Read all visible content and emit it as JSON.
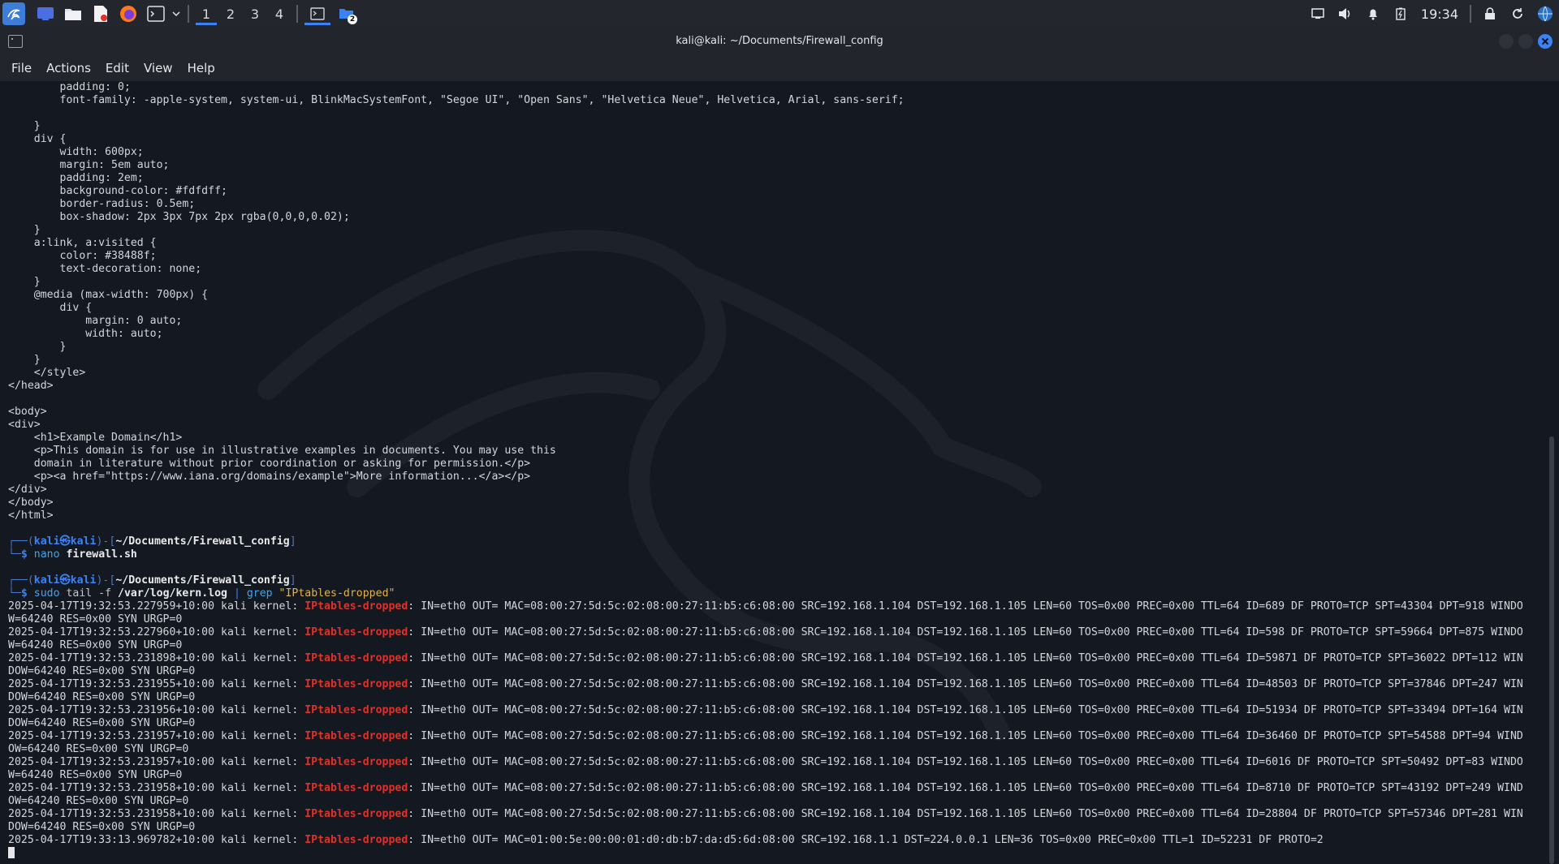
{
  "taskbar": {
    "workspaces": [
      "1",
      "2",
      "3",
      "4"
    ],
    "active_workspace": 0,
    "clock": "19:34",
    "badge": "2",
    "icons": [
      "kali-menu-icon",
      "desktop-icon",
      "file-manager-icon",
      "text-editor-icon",
      "firefox-icon",
      "terminal-icon",
      "dropdown-icon"
    ],
    "tray_icons": [
      "display-icon",
      "volume-icon",
      "bell-icon",
      "battery-icon",
      "lock-icon",
      "refresh-icon",
      "network-icon"
    ]
  },
  "window": {
    "title": "kali@kali: ~/Documents/Firewall_config"
  },
  "menu": [
    "File",
    "Actions",
    "Edit",
    "View",
    "Help"
  ],
  "terminal": {
    "html_lines": [
      "        padding: 0;",
      "        font-family: -apple-system, system-ui, BlinkMacSystemFont, \"Segoe UI\", \"Open Sans\", \"Helvetica Neue\", Helvetica, Arial, sans-serif;",
      "",
      "    }",
      "    div {",
      "        width: 600px;",
      "        margin: 5em auto;",
      "        padding: 2em;",
      "        background-color: #fdfdff;",
      "        border-radius: 0.5em;",
      "        box-shadow: 2px 3px 7px 2px rgba(0,0,0,0.02);",
      "    }",
      "    a:link, a:visited {",
      "        color: #38488f;",
      "        text-decoration: none;",
      "    }",
      "    @media (max-width: 700px) {",
      "        div {",
      "            margin: 0 auto;",
      "            width: auto;",
      "        }",
      "    }",
      "    </style>",
      "</head>",
      "",
      "<body>",
      "<div>",
      "    <h1>Example Domain</h1>",
      "    <p>This domain is for use in illustrative examples in documents. You may use this",
      "    domain in literature without prior coordination or asking for permission.</p>",
      "    <p><a href=\"https://www.iana.org/domains/example\">More information...</a></p>",
      "</div>",
      "</body>",
      "</html>",
      ""
    ],
    "prompts": [
      {
        "user": "kali",
        "host": "kali",
        "path": "~/Documents/Firewall_config",
        "cmd_name": "nano",
        "cmd_bold": "firewall.sh",
        "cmd_rest": "",
        "grep": "",
        "grep_str": ""
      },
      {
        "user": "kali",
        "host": "kali",
        "path": "~/Documents/Firewall_config",
        "cmd_name": "sudo",
        "cmd_mid": " tail -f ",
        "cmd_bold": "/var/log/kern.log",
        "pipe": " | ",
        "grep": "grep",
        "grep_str": " \"IPtables-dropped\""
      }
    ],
    "log_entries": [
      {
        "ts": "2025-04-17T19:32:53.227959+10:00 kali kernel: ",
        "tag": "IPtables-dropped",
        "rest1": ": IN=eth0 OUT= MAC=08:00:27:5d:5c:02:08:00:27:11:b5:c6:08:00 SRC=192.168.1.104 DST=192.168.1.105 LEN=60 TOS=0x00 PREC=0x00 TTL=64 ID=689 DF PROTO=TCP SPT=43304 DPT=918 WINDO",
        "rest2": "W=64240 RES=0x00 SYN URGP=0"
      },
      {
        "ts": "2025-04-17T19:32:53.227960+10:00 kali kernel: ",
        "tag": "IPtables-dropped",
        "rest1": ": IN=eth0 OUT= MAC=08:00:27:5d:5c:02:08:00:27:11:b5:c6:08:00 SRC=192.168.1.104 DST=192.168.1.105 LEN=60 TOS=0x00 PREC=0x00 TTL=64 ID=598 DF PROTO=TCP SPT=59664 DPT=875 WINDO",
        "rest2": "W=64240 RES=0x00 SYN URGP=0"
      },
      {
        "ts": "2025-04-17T19:32:53.231898+10:00 kali kernel: ",
        "tag": "IPtables-dropped",
        "rest1": ": IN=eth0 OUT= MAC=08:00:27:5d:5c:02:08:00:27:11:b5:c6:08:00 SRC=192.168.1.104 DST=192.168.1.105 LEN=60 TOS=0x00 PREC=0x00 TTL=64 ID=59871 DF PROTO=TCP SPT=36022 DPT=112 WIN",
        "rest2": "DOW=64240 RES=0x00 SYN URGP=0"
      },
      {
        "ts": "2025-04-17T19:32:53.231955+10:00 kali kernel: ",
        "tag": "IPtables-dropped",
        "rest1": ": IN=eth0 OUT= MAC=08:00:27:5d:5c:02:08:00:27:11:b5:c6:08:00 SRC=192.168.1.104 DST=192.168.1.105 LEN=60 TOS=0x00 PREC=0x00 TTL=64 ID=48503 DF PROTO=TCP SPT=37846 DPT=247 WIN",
        "rest2": "DOW=64240 RES=0x00 SYN URGP=0"
      },
      {
        "ts": "2025-04-17T19:32:53.231956+10:00 kali kernel: ",
        "tag": "IPtables-dropped",
        "rest1": ": IN=eth0 OUT= MAC=08:00:27:5d:5c:02:08:00:27:11:b5:c6:08:00 SRC=192.168.1.104 DST=192.168.1.105 LEN=60 TOS=0x00 PREC=0x00 TTL=64 ID=51934 DF PROTO=TCP SPT=33494 DPT=164 WIN",
        "rest2": "DOW=64240 RES=0x00 SYN URGP=0"
      },
      {
        "ts": "2025-04-17T19:32:53.231957+10:00 kali kernel: ",
        "tag": "IPtables-dropped",
        "rest1": ": IN=eth0 OUT= MAC=08:00:27:5d:5c:02:08:00:27:11:b5:c6:08:00 SRC=192.168.1.104 DST=192.168.1.105 LEN=60 TOS=0x00 PREC=0x00 TTL=64 ID=36460 DF PROTO=TCP SPT=54588 DPT=94 WIND",
        "rest2": "OW=64240 RES=0x00 SYN URGP=0"
      },
      {
        "ts": "2025-04-17T19:32:53.231957+10:00 kali kernel: ",
        "tag": "IPtables-dropped",
        "rest1": ": IN=eth0 OUT= MAC=08:00:27:5d:5c:02:08:00:27:11:b5:c6:08:00 SRC=192.168.1.104 DST=192.168.1.105 LEN=60 TOS=0x00 PREC=0x00 TTL=64 ID=6016 DF PROTO=TCP SPT=50492 DPT=83 WINDO",
        "rest2": "W=64240 RES=0x00 SYN URGP=0"
      },
      {
        "ts": "2025-04-17T19:32:53.231958+10:00 kali kernel: ",
        "tag": "IPtables-dropped",
        "rest1": ": IN=eth0 OUT= MAC=08:00:27:5d:5c:02:08:00:27:11:b5:c6:08:00 SRC=192.168.1.104 DST=192.168.1.105 LEN=60 TOS=0x00 PREC=0x00 TTL=64 ID=8710 DF PROTO=TCP SPT=43192 DPT=249 WIND",
        "rest2": "OW=64240 RES=0x00 SYN URGP=0"
      },
      {
        "ts": "2025-04-17T19:32:53.231958+10:00 kali kernel: ",
        "tag": "IPtables-dropped",
        "rest1": ": IN=eth0 OUT= MAC=08:00:27:5d:5c:02:08:00:27:11:b5:c6:08:00 SRC=192.168.1.104 DST=192.168.1.105 LEN=60 TOS=0x00 PREC=0x00 TTL=64 ID=28804 DF PROTO=TCP SPT=57346 DPT=281 WIN",
        "rest2": "DOW=64240 RES=0x00 SYN URGP=0"
      },
      {
        "ts": "2025-04-17T19:33:13.969782+10:00 kali kernel: ",
        "tag": "IPtables-dropped",
        "rest1": ": IN=eth0 OUT= MAC=01:00:5e:00:00:01:d0:db:b7:da:d5:6d:08:00 SRC=192.168.1.1 DST=224.0.0.1 LEN=36 TOS=0x00 PREC=0x00 TTL=1 ID=52231 DF PROTO=2",
        "rest2": null
      }
    ]
  },
  "colors": {
    "accent": "#3b82f6",
    "dropped": "#e0312a",
    "grep_string": "#e0b34a",
    "terminal_bg": "#141820"
  }
}
